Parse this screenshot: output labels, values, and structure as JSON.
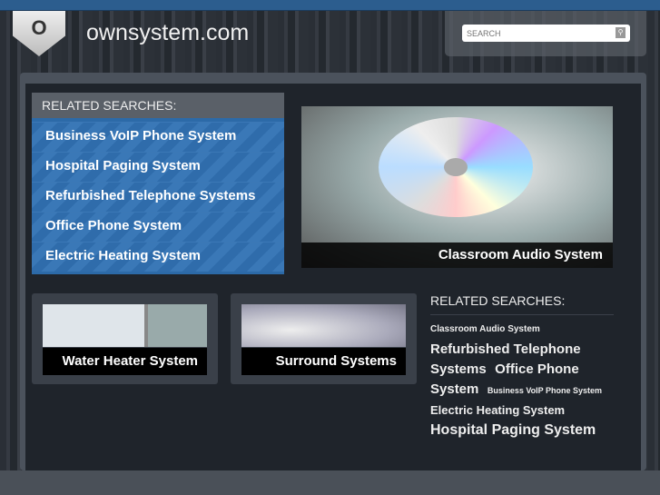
{
  "header": {
    "logo_letter": "O",
    "site_title": "ownsystem.com",
    "search_placeholder": "SEARCH"
  },
  "related_box": {
    "heading": "RELATED SEARCHES:",
    "items": [
      "Business VoIP Phone System",
      "Hospital Paging System",
      "Refurbished Telephone Systems",
      "Office Phone System",
      "Electric Heating System"
    ]
  },
  "hero": {
    "caption": "Classroom Audio System"
  },
  "thumbs": [
    {
      "caption": "Water Heater System"
    },
    {
      "caption": "Surround Systems"
    }
  ],
  "related_cloud": {
    "heading": "RELATED SEARCHES:",
    "tags": [
      "Classroom Audio System",
      "Refurbished Telephone Systems",
      "Office Phone System",
      "Business VoIP Phone System",
      "Electric Heating System",
      "Hospital Paging System"
    ]
  }
}
